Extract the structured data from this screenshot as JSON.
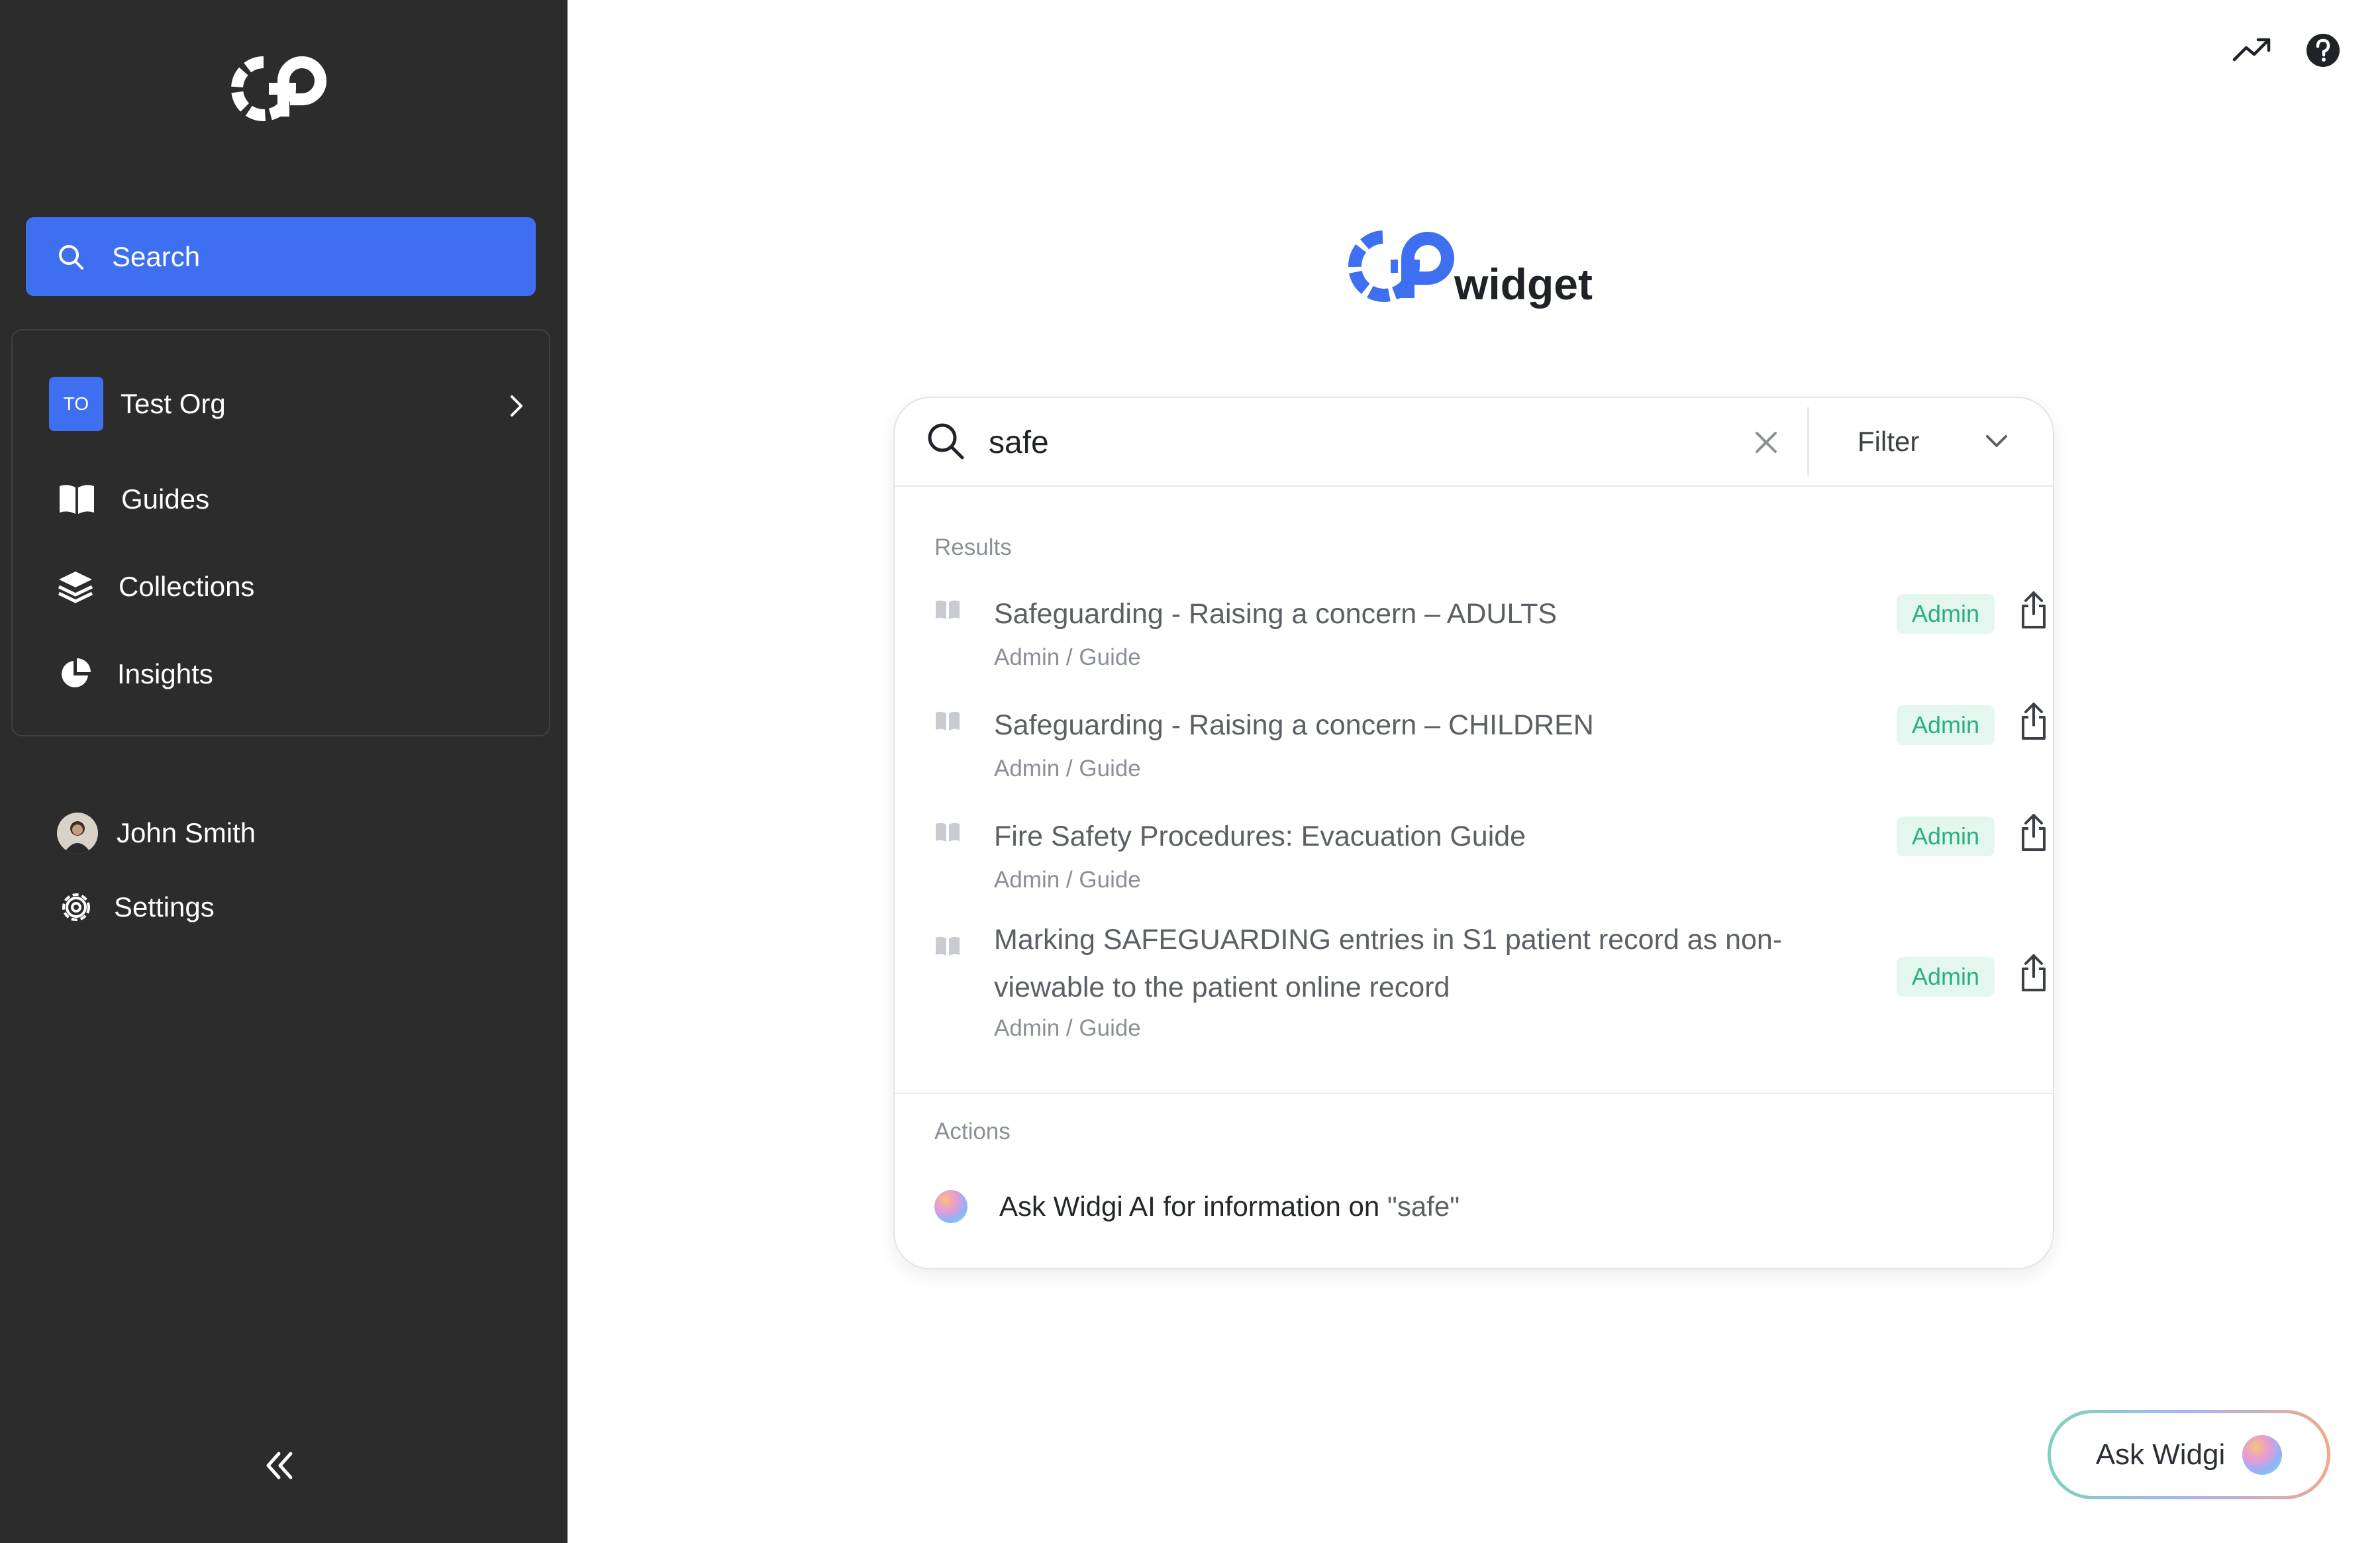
{
  "sidebar": {
    "search_label": "Search",
    "org": {
      "badge": "TO",
      "name": "Test Org"
    },
    "items": [
      {
        "label": "Guides",
        "icon": "book-icon"
      },
      {
        "label": "Collections",
        "icon": "layers-icon"
      },
      {
        "label": "Insights",
        "icon": "pie-chart-icon"
      }
    ],
    "user": {
      "name": "John Smith"
    },
    "settings_label": "Settings"
  },
  "search": {
    "value": "safe",
    "filter_label": "Filter"
  },
  "results": {
    "heading": "Results",
    "items": [
      {
        "title": "Safeguarding - Raising a concern – ADULTS",
        "path": "Admin / Guide",
        "badge": "Admin"
      },
      {
        "title": "Safeguarding - Raising a concern – CHILDREN",
        "path": "Admin / Guide",
        "badge": "Admin"
      },
      {
        "title": "Fire Safety Procedures: Evacuation Guide",
        "path": "Admin / Guide",
        "badge": "Admin"
      },
      {
        "title": "Marking SAFEGUARDING entries in S1 patient record as non-viewable to the patient online record",
        "path": "Admin / Guide",
        "badge": "Admin"
      }
    ]
  },
  "actions": {
    "heading": "Actions",
    "ai_prefix": "Ask Widgi AI for information on ",
    "ai_query": "\"safe\""
  },
  "ask_widgi_label": "Ask Widgi",
  "logo": {
    "word": "widget"
  },
  "colors": {
    "accent": "#3d6ff0",
    "sidebar_bg": "#2c2c2c",
    "badge_bg": "#e3f7ef",
    "badge_text": "#2ab07c"
  }
}
